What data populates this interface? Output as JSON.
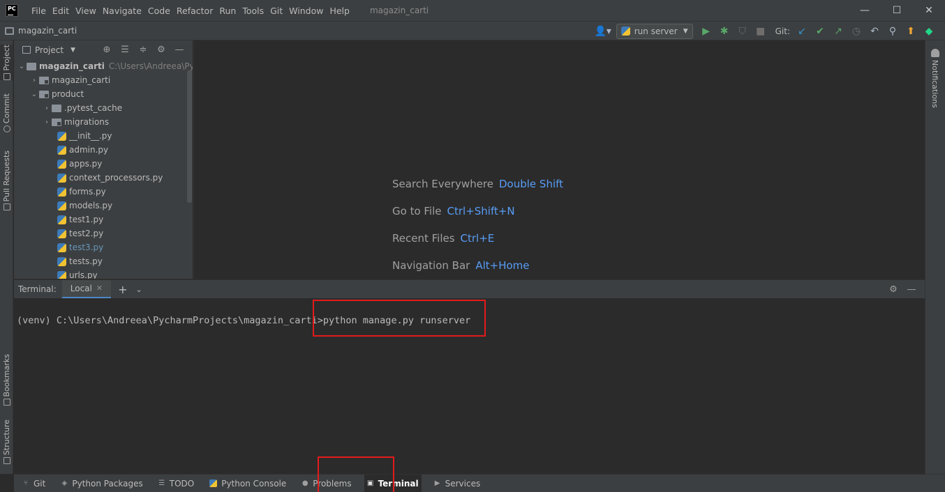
{
  "window": {
    "title": "magazin_carti",
    "logo_text": "PC",
    "menu": [
      "File",
      "Edit",
      "View",
      "Navigate",
      "Code",
      "Refactor",
      "Run",
      "Tools",
      "Git",
      "Window",
      "Help"
    ],
    "minimize": "—",
    "maximize": "☐",
    "close": "✕"
  },
  "navbar": {
    "breadcrumb": "magazin_carti",
    "run_config": "run server",
    "git_label": "Git:"
  },
  "left_strip": {
    "project": "Project",
    "commit": "Commit",
    "pull_requests": "Pull Requests",
    "bookmarks": "Bookmarks",
    "structure": "Structure"
  },
  "right_strip": {
    "notifications": "Notifications"
  },
  "project_panel": {
    "title": "Project",
    "root": {
      "name": "magazin_carti",
      "path": "C:\\Users\\Andreea\\Pychar"
    },
    "items": [
      {
        "name": "magazin_carti"
      },
      {
        "name": "product"
      },
      {
        "name": ".pytest_cache"
      },
      {
        "name": "migrations"
      },
      {
        "name": "__init__.py"
      },
      {
        "name": "admin.py"
      },
      {
        "name": "apps.py"
      },
      {
        "name": "context_processors.py"
      },
      {
        "name": "forms.py"
      },
      {
        "name": "models.py"
      },
      {
        "name": "test1.py"
      },
      {
        "name": "test2.py"
      },
      {
        "name": "test3.py"
      },
      {
        "name": "tests.py"
      },
      {
        "name": "urls.py"
      }
    ]
  },
  "editor": {
    "hints": [
      {
        "label": "Search Everywhere",
        "key": "Double Shift"
      },
      {
        "label": "Go to File",
        "key": "Ctrl+Shift+N"
      },
      {
        "label": "Recent Files",
        "key": "Ctrl+E"
      },
      {
        "label": "Navigation Bar",
        "key": "Alt+Home"
      }
    ]
  },
  "terminal": {
    "title": "Terminal:",
    "tab": "Local",
    "prompt": "(venv) C:\\Users\\Andreea\\PycharmProjects\\magazin_carti>",
    "command": "python manage.py runserver"
  },
  "bottom_bar": {
    "items": [
      "Git",
      "Python Packages",
      "TODO",
      "Python Console",
      "Problems",
      "Terminal",
      "Services"
    ],
    "active": "Terminal"
  },
  "colors": {
    "background": "#2b2b2b",
    "panel": "#3c3f41",
    "accent": "#589df6",
    "highlight_box": "#e31b1b"
  }
}
